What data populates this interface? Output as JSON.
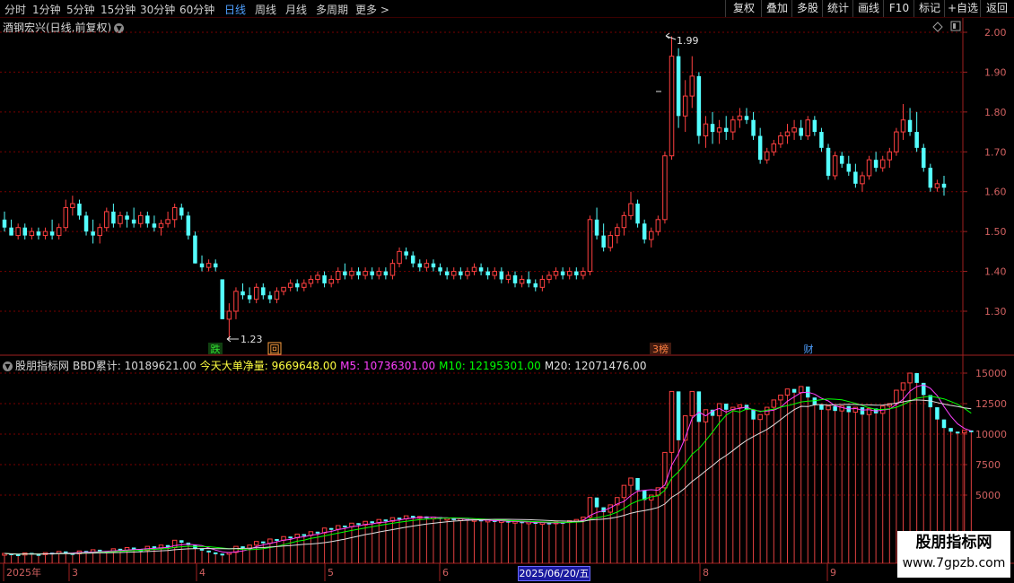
{
  "toolbar": {
    "periods": [
      "分时",
      "1分钟",
      "5分钟",
      "15分钟",
      "30分钟",
      "60分钟",
      "日线",
      "周线",
      "月线",
      "多周期",
      "更多 >"
    ],
    "active_period": "日线",
    "right_buttons": [
      "复权",
      "叠加",
      "多股",
      "统计",
      "画线",
      "F10",
      "标记",
      "+自选",
      "返回"
    ]
  },
  "main_chart": {
    "title": "酒钢宏兴(日线,前复权)",
    "y_axis": [
      "2.00",
      "1.90",
      "1.80",
      "1.70",
      "1.60",
      "1.50",
      "1.40",
      "1.30"
    ],
    "high_label": "1.99",
    "low_label": "1.23",
    "markers": [
      {
        "text": "跌",
        "color": "#30e030"
      },
      {
        "text": "回",
        "color": "#ffa040"
      },
      {
        "text": "3榜",
        "color": "#ff8040"
      },
      {
        "text": "财",
        "color": "#4fa0ff"
      }
    ]
  },
  "indicator": {
    "name": "股朋指标网",
    "bbd_label": "BBD累计: 10189621.00",
    "net_label": "今天大单净量: 9669648.00",
    "m5_label": "M5: 10736301.00",
    "m10_label": "M10: 12195301.00",
    "m20_label": "M20: 12071476.00",
    "y_axis": [
      "15000",
      "12500",
      "10000",
      "7500",
      "5000"
    ]
  },
  "x_axis": {
    "labels": [
      "2025年",
      "3",
      "4",
      "5",
      "6",
      "8",
      "9"
    ],
    "cursor_date": "2025/06/20/五"
  },
  "watermark": {
    "title": "股朋指标网",
    "url": "www.7gpzb.com"
  },
  "colors": {
    "up": "#ff4040",
    "down": "#54ffff",
    "grid": "#7a0000",
    "m5": "#ff40ff",
    "m10": "#00ff00",
    "m20": "#e0e0e0"
  },
  "chart_data": {
    "type": "candlestick",
    "ohlc": [
      [
        1.53,
        1.55,
        1.5,
        1.51
      ],
      [
        1.51,
        1.53,
        1.49,
        1.49
      ],
      [
        1.49,
        1.52,
        1.48,
        1.51
      ],
      [
        1.51,
        1.52,
        1.48,
        1.49
      ],
      [
        1.49,
        1.51,
        1.48,
        1.5
      ],
      [
        1.5,
        1.51,
        1.48,
        1.49
      ],
      [
        1.49,
        1.51,
        1.48,
        1.5
      ],
      [
        1.5,
        1.53,
        1.48,
        1.49
      ],
      [
        1.49,
        1.52,
        1.48,
        1.51
      ],
      [
        1.51,
        1.58,
        1.5,
        1.56
      ],
      [
        1.56,
        1.59,
        1.54,
        1.57
      ],
      [
        1.57,
        1.58,
        1.53,
        1.54
      ],
      [
        1.54,
        1.55,
        1.49,
        1.5
      ],
      [
        1.5,
        1.53,
        1.47,
        1.49
      ],
      [
        1.49,
        1.52,
        1.47,
        1.51
      ],
      [
        1.51,
        1.56,
        1.5,
        1.55
      ],
      [
        1.55,
        1.57,
        1.51,
        1.52
      ],
      [
        1.52,
        1.55,
        1.51,
        1.54
      ],
      [
        1.54,
        1.55,
        1.51,
        1.53
      ],
      [
        1.53,
        1.56,
        1.51,
        1.52
      ],
      [
        1.52,
        1.55,
        1.51,
        1.54
      ],
      [
        1.54,
        1.55,
        1.51,
        1.52
      ],
      [
        1.52,
        1.54,
        1.5,
        1.51
      ],
      [
        1.51,
        1.53,
        1.49,
        1.52
      ],
      [
        1.52,
        1.55,
        1.51,
        1.53
      ],
      [
        1.53,
        1.57,
        1.51,
        1.56
      ],
      [
        1.56,
        1.57,
        1.53,
        1.54
      ],
      [
        1.54,
        1.55,
        1.48,
        1.49
      ],
      [
        1.49,
        1.5,
        1.42,
        1.42
      ],
      [
        1.42,
        1.44,
        1.4,
        1.41
      ],
      [
        1.41,
        1.43,
        1.4,
        1.42
      ],
      [
        1.42,
        1.43,
        1.4,
        1.41
      ],
      [
        1.38,
        1.38,
        1.28,
        1.28
      ],
      [
        1.28,
        1.32,
        1.23,
        1.3
      ],
      [
        1.3,
        1.36,
        1.28,
        1.35
      ],
      [
        1.35,
        1.37,
        1.33,
        1.34
      ],
      [
        1.34,
        1.36,
        1.32,
        1.33
      ],
      [
        1.33,
        1.37,
        1.32,
        1.36
      ],
      [
        1.36,
        1.37,
        1.33,
        1.34
      ],
      [
        1.34,
        1.35,
        1.32,
        1.33
      ],
      [
        1.33,
        1.36,
        1.32,
        1.35
      ],
      [
        1.35,
        1.36,
        1.34,
        1.36
      ],
      [
        1.36,
        1.38,
        1.35,
        1.37
      ],
      [
        1.37,
        1.38,
        1.35,
        1.36
      ],
      [
        1.36,
        1.38,
        1.35,
        1.37
      ],
      [
        1.37,
        1.39,
        1.36,
        1.38
      ],
      [
        1.38,
        1.4,
        1.37,
        1.39
      ],
      [
        1.39,
        1.4,
        1.36,
        1.37
      ],
      [
        1.37,
        1.39,
        1.36,
        1.38
      ],
      [
        1.38,
        1.41,
        1.37,
        1.4
      ],
      [
        1.4,
        1.42,
        1.38,
        1.39
      ],
      [
        1.39,
        1.41,
        1.38,
        1.4
      ],
      [
        1.4,
        1.41,
        1.38,
        1.39
      ],
      [
        1.39,
        1.41,
        1.38,
        1.4
      ],
      [
        1.4,
        1.41,
        1.38,
        1.39
      ],
      [
        1.39,
        1.41,
        1.38,
        1.4
      ],
      [
        1.4,
        1.41,
        1.38,
        1.39
      ],
      [
        1.39,
        1.43,
        1.38,
        1.42
      ],
      [
        1.42,
        1.46,
        1.41,
        1.45
      ],
      [
        1.45,
        1.46,
        1.43,
        1.44
      ],
      [
        1.44,
        1.45,
        1.41,
        1.42
      ],
      [
        1.42,
        1.43,
        1.4,
        1.41
      ],
      [
        1.41,
        1.43,
        1.4,
        1.42
      ],
      [
        1.42,
        1.43,
        1.4,
        1.41
      ],
      [
        1.41,
        1.42,
        1.39,
        1.4
      ],
      [
        1.4,
        1.41,
        1.38,
        1.39
      ],
      [
        1.39,
        1.41,
        1.38,
        1.4
      ],
      [
        1.4,
        1.41,
        1.38,
        1.39
      ],
      [
        1.39,
        1.41,
        1.38,
        1.4
      ],
      [
        1.4,
        1.42,
        1.39,
        1.41
      ],
      [
        1.41,
        1.42,
        1.39,
        1.4
      ],
      [
        1.4,
        1.41,
        1.38,
        1.39
      ],
      [
        1.39,
        1.41,
        1.38,
        1.4
      ],
      [
        1.4,
        1.41,
        1.37,
        1.38
      ],
      [
        1.38,
        1.4,
        1.37,
        1.39
      ],
      [
        1.39,
        1.4,
        1.36,
        1.37
      ],
      [
        1.37,
        1.39,
        1.36,
        1.38
      ],
      [
        1.38,
        1.4,
        1.36,
        1.37
      ],
      [
        1.37,
        1.38,
        1.35,
        1.36
      ],
      [
        1.36,
        1.39,
        1.35,
        1.38
      ],
      [
        1.38,
        1.4,
        1.37,
        1.39
      ],
      [
        1.39,
        1.41,
        1.38,
        1.4
      ],
      [
        1.4,
        1.41,
        1.38,
        1.39
      ],
      [
        1.39,
        1.41,
        1.38,
        1.4
      ],
      [
        1.4,
        1.41,
        1.38,
        1.39
      ],
      [
        1.39,
        1.41,
        1.38,
        1.4
      ],
      [
        1.4,
        1.54,
        1.39,
        1.53
      ],
      [
        1.53,
        1.56,
        1.48,
        1.49
      ],
      [
        1.49,
        1.52,
        1.45,
        1.46
      ],
      [
        1.46,
        1.5,
        1.45,
        1.49
      ],
      [
        1.49,
        1.52,
        1.47,
        1.51
      ],
      [
        1.51,
        1.55,
        1.49,
        1.54
      ],
      [
        1.54,
        1.6,
        1.53,
        1.57
      ],
      [
        1.57,
        1.58,
        1.51,
        1.52
      ],
      [
        1.52,
        1.53,
        1.47,
        1.48
      ],
      [
        1.48,
        1.51,
        1.46,
        1.5
      ],
      [
        1.5,
        1.54,
        1.49,
        1.53
      ],
      [
        1.53,
        1.7,
        1.52,
        1.69
      ],
      [
        1.69,
        1.99,
        1.68,
        1.94
      ],
      [
        1.94,
        1.96,
        1.76,
        1.79
      ],
      [
        1.79,
        1.88,
        1.75,
        1.84
      ],
      [
        1.84,
        1.94,
        1.81,
        1.89
      ],
      [
        1.89,
        1.9,
        1.72,
        1.74
      ],
      [
        1.74,
        1.79,
        1.71,
        1.77
      ],
      [
        1.77,
        1.8,
        1.72,
        1.75
      ],
      [
        1.75,
        1.78,
        1.72,
        1.76
      ],
      [
        1.76,
        1.79,
        1.73,
        1.75
      ],
      [
        1.75,
        1.79,
        1.73,
        1.78
      ],
      [
        1.78,
        1.81,
        1.76,
        1.79
      ],
      [
        1.79,
        1.81,
        1.77,
        1.78
      ],
      [
        1.78,
        1.8,
        1.73,
        1.74
      ],
      [
        1.74,
        1.76,
        1.67,
        1.68
      ],
      [
        1.68,
        1.71,
        1.67,
        1.7
      ],
      [
        1.7,
        1.73,
        1.69,
        1.72
      ],
      [
        1.72,
        1.75,
        1.71,
        1.74
      ],
      [
        1.74,
        1.77,
        1.72,
        1.75
      ],
      [
        1.75,
        1.78,
        1.73,
        1.76
      ],
      [
        1.76,
        1.78,
        1.73,
        1.74
      ],
      [
        1.74,
        1.79,
        1.73,
        1.78
      ],
      [
        1.78,
        1.79,
        1.74,
        1.75
      ],
      [
        1.75,
        1.76,
        1.7,
        1.71
      ],
      [
        1.71,
        1.72,
        1.63,
        1.64
      ],
      [
        1.64,
        1.7,
        1.63,
        1.69
      ],
      [
        1.69,
        1.7,
        1.66,
        1.67
      ],
      [
        1.67,
        1.69,
        1.64,
        1.65
      ],
      [
        1.65,
        1.67,
        1.61,
        1.62
      ],
      [
        1.62,
        1.65,
        1.6,
        1.64
      ],
      [
        1.64,
        1.69,
        1.63,
        1.68
      ],
      [
        1.68,
        1.7,
        1.65,
        1.66
      ],
      [
        1.66,
        1.69,
        1.65,
        1.68
      ],
      [
        1.68,
        1.71,
        1.66,
        1.7
      ],
      [
        1.7,
        1.76,
        1.69,
        1.75
      ],
      [
        1.75,
        1.82,
        1.73,
        1.78
      ],
      [
        1.78,
        1.81,
        1.74,
        1.75
      ],
      [
        1.75,
        1.8,
        1.7,
        1.71
      ],
      [
        1.71,
        1.72,
        1.65,
        1.66
      ],
      [
        1.66,
        1.67,
        1.6,
        1.61
      ],
      [
        1.61,
        1.63,
        1.6,
        1.62
      ],
      [
        1.62,
        1.64,
        1.59,
        1.61
      ]
    ],
    "bbd": [
      [
        80,
        220
      ],
      [
        220,
        150
      ],
      [
        150,
        90
      ],
      [
        90,
        260
      ],
      [
        260,
        170
      ],
      [
        170,
        120
      ],
      [
        120,
        280
      ],
      [
        280,
        200
      ],
      [
        200,
        380
      ],
      [
        380,
        250
      ],
      [
        250,
        180
      ],
      [
        180,
        420
      ],
      [
        420,
        310
      ],
      [
        310,
        520
      ],
      [
        520,
        400
      ],
      [
        400,
        330
      ],
      [
        330,
        600
      ],
      [
        600,
        480
      ],
      [
        480,
        700
      ],
      [
        700,
        550
      ],
      [
        550,
        470
      ],
      [
        470,
        800
      ],
      [
        800,
        650
      ],
      [
        650,
        900
      ],
      [
        900,
        700
      ],
      [
        700,
        1300
      ],
      [
        1300,
        1100
      ],
      [
        1100,
        900
      ],
      [
        900,
        600
      ],
      [
        600,
        450
      ],
      [
        450,
        300
      ],
      [
        300,
        200
      ],
      [
        200,
        150
      ],
      [
        150,
        300
      ],
      [
        300,
        800
      ],
      [
        800,
        650
      ],
      [
        650,
        900
      ],
      [
        900,
        1200
      ],
      [
        1200,
        1050
      ],
      [
        1050,
        1400
      ],
      [
        1400,
        1300
      ],
      [
        1300,
        1600
      ],
      [
        1600,
        1500
      ],
      [
        1500,
        1800
      ],
      [
        1800,
        1700
      ],
      [
        1700,
        2000
      ],
      [
        2000,
        1900
      ],
      [
        1900,
        2300
      ],
      [
        2300,
        2200
      ],
      [
        2200,
        2500
      ],
      [
        2500,
        2400
      ],
      [
        2400,
        2700
      ],
      [
        2700,
        2550
      ],
      [
        2550,
        2850
      ],
      [
        2850,
        2700
      ],
      [
        2700,
        3000
      ],
      [
        3000,
        2850
      ],
      [
        2850,
        3150
      ],
      [
        3150,
        3050
      ],
      [
        3050,
        3300
      ],
      [
        3300,
        3150
      ],
      [
        3150,
        3250
      ],
      [
        3250,
        3100
      ],
      [
        3100,
        3200
      ],
      [
        3200,
        3050
      ],
      [
        3050,
        3100
      ],
      [
        3100,
        2950
      ],
      [
        2950,
        3050
      ],
      [
        3050,
        2900
      ],
      [
        2900,
        3000
      ],
      [
        3000,
        2850
      ],
      [
        2850,
        2950
      ],
      [
        2950,
        2800
      ],
      [
        2800,
        2900
      ],
      [
        2900,
        2750
      ],
      [
        2750,
        2850
      ],
      [
        2850,
        2700
      ],
      [
        2700,
        2800
      ],
      [
        2800,
        2650
      ],
      [
        2650,
        2750
      ],
      [
        2750,
        2700
      ],
      [
        2700,
        2800
      ],
      [
        2800,
        2750
      ],
      [
        2750,
        2900
      ],
      [
        2900,
        3000
      ],
      [
        3000,
        3200
      ],
      [
        3200,
        4800
      ],
      [
        4800,
        4000
      ],
      [
        4000,
        3600
      ],
      [
        3600,
        4200
      ],
      [
        4200,
        4800
      ],
      [
        4800,
        5800
      ],
      [
        5800,
        6400
      ],
      [
        6400,
        5400
      ],
      [
        5400,
        4600
      ],
      [
        4600,
        5000
      ],
      [
        5000,
        5600
      ],
      [
        5600,
        8500
      ],
      [
        8500,
        13500
      ],
      [
        13500,
        9500
      ],
      [
        9500,
        11500
      ],
      [
        11500,
        13500
      ],
      [
        13500,
        11000
      ],
      [
        11000,
        12000
      ],
      [
        12000,
        11500
      ],
      [
        11500,
        12500
      ],
      [
        12500,
        12000
      ],
      [
        12000,
        12200
      ],
      [
        12200,
        12400
      ],
      [
        12400,
        12000
      ],
      [
        12000,
        11200
      ],
      [
        11200,
        11600
      ],
      [
        11600,
        12200
      ],
      [
        12200,
        12800
      ],
      [
        12800,
        13200
      ],
      [
        13200,
        13700
      ],
      [
        13700,
        13400
      ],
      [
        13400,
        13900
      ],
      [
        13900,
        13000
      ],
      [
        13000,
        12400
      ],
      [
        12400,
        12000
      ],
      [
        12000,
        12300
      ],
      [
        12300,
        11900
      ],
      [
        11900,
        12300
      ],
      [
        12300,
        11800
      ],
      [
        11800,
        12200
      ],
      [
        12200,
        11600
      ],
      [
        11600,
        12100
      ],
      [
        12100,
        11700
      ],
      [
        11700,
        12300
      ],
      [
        12300,
        12500
      ],
      [
        12500,
        13600
      ],
      [
        13600,
        14200
      ],
      [
        14200,
        15000
      ],
      [
        15000,
        14200
      ],
      [
        14200,
        13200
      ],
      [
        13200,
        12200
      ],
      [
        12200,
        11200
      ],
      [
        11200,
        10500
      ],
      [
        10500,
        10200
      ],
      [
        10200,
        10100
      ],
      [
        10100,
        10300
      ],
      [
        10300,
        10200
      ]
    ]
  }
}
